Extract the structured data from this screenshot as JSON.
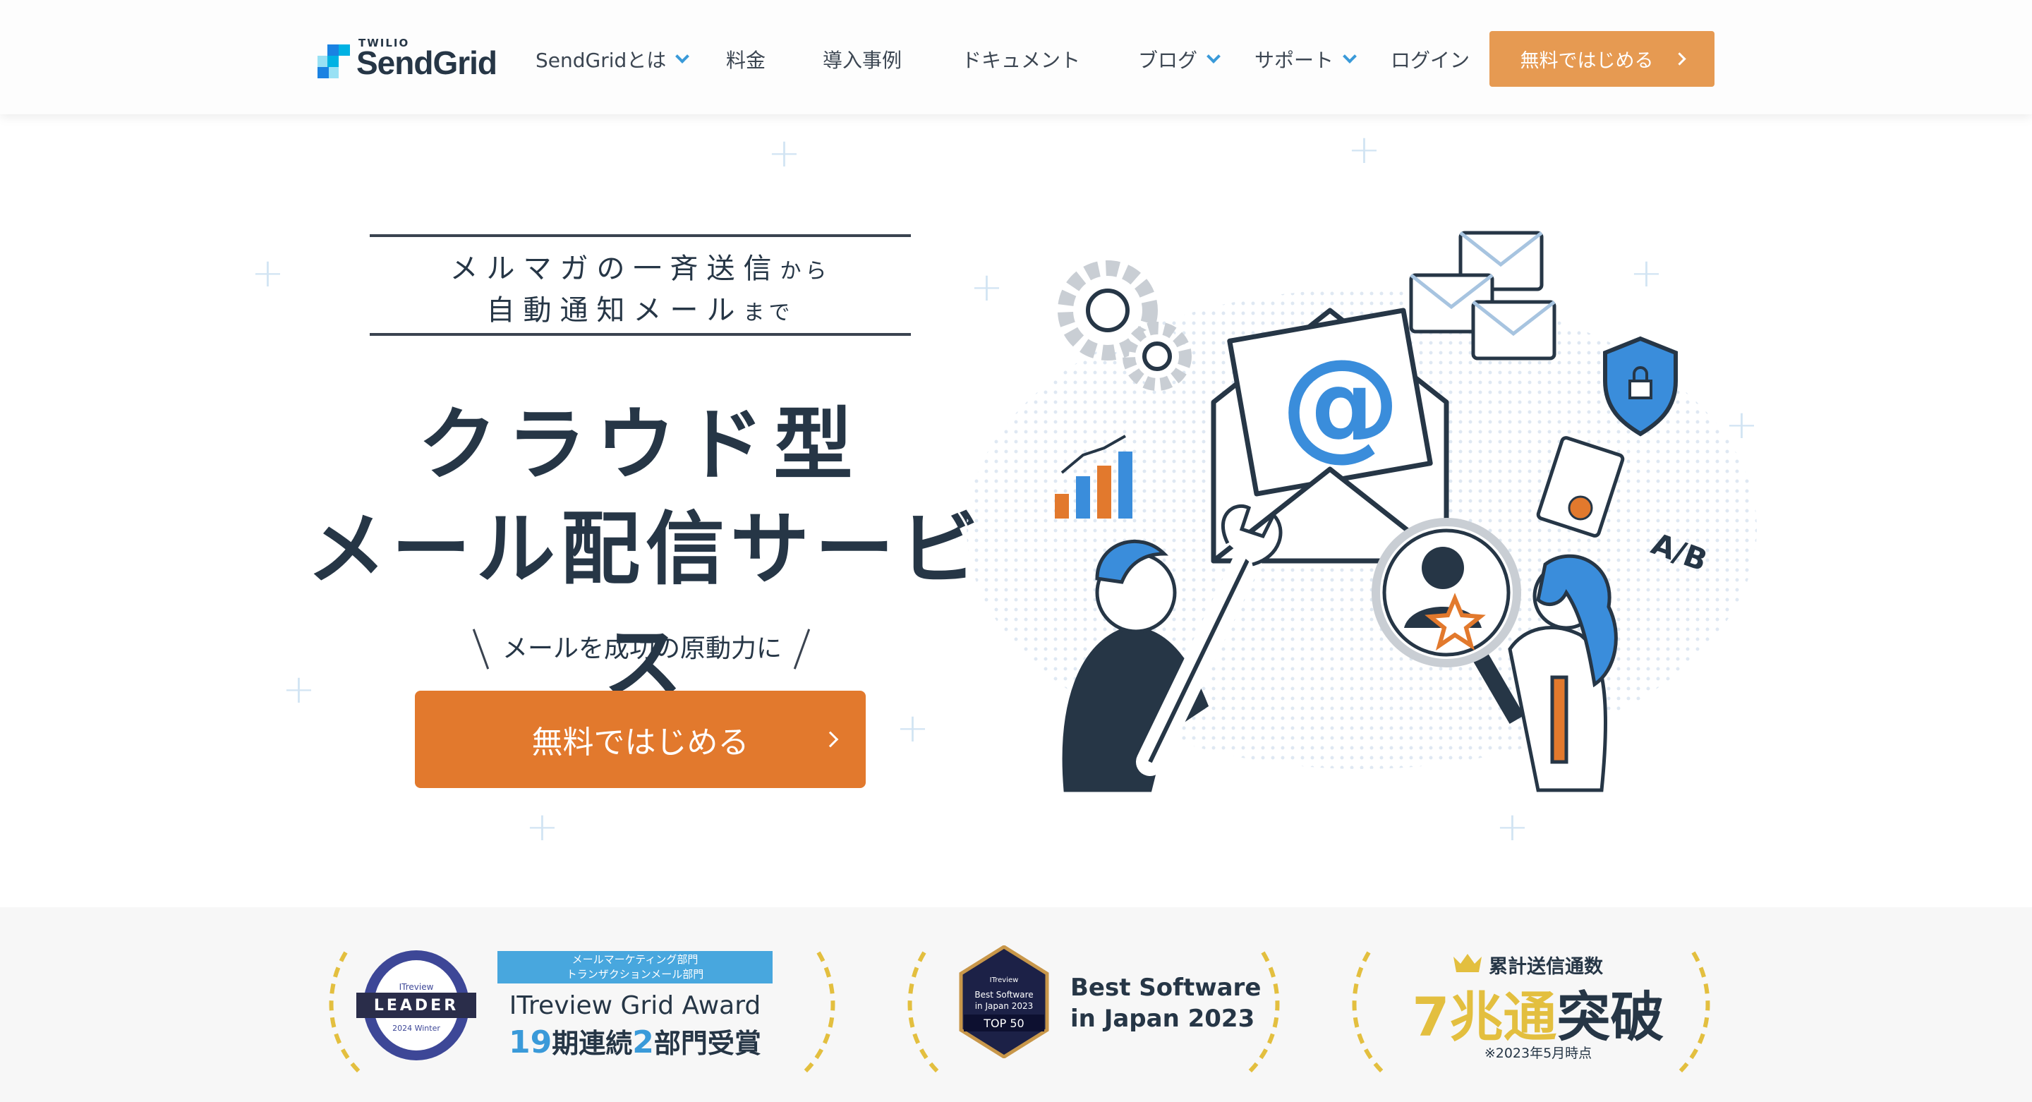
{
  "header": {
    "logo": {
      "small": "TWILIO",
      "name": "SendGrid"
    },
    "nav": [
      {
        "label": "SendGridとは",
        "dropdown": true
      },
      {
        "label": "料金",
        "dropdown": false
      },
      {
        "label": "導入事例",
        "dropdown": false
      },
      {
        "label": "ドキュメント",
        "dropdown": false
      },
      {
        "label": "ブログ",
        "dropdown": true
      },
      {
        "label": "サポート",
        "dropdown": true
      },
      {
        "label": "ログイン",
        "dropdown": false
      }
    ],
    "cta_label": "無料ではじめる"
  },
  "hero": {
    "tagline_line1": "メルマガの一斉送信",
    "tagline_line1_small": "から",
    "tagline_line2": "自動通知メール",
    "tagline_line2_small": "まで",
    "headline_line1": "クラウド型",
    "headline_line2": "メール配信サービス",
    "subline": "メールを成功の原動力に",
    "cta_label": "無料ではじめる",
    "illustration_text": "A/B"
  },
  "awards": [
    {
      "badge_brand": "ITreview",
      "badge_title": "LEADER",
      "badge_season": "2024 Winter",
      "ribbon_line1": "メールマーケティング部門",
      "ribbon_line2": "トランザクションメール部門",
      "title": "ITreview Grid Award",
      "highlight_num1": "19",
      "text1": "期連続",
      "highlight_num2": "2",
      "text2": "部門受賞"
    },
    {
      "badge_brand": "ITreview",
      "badge_line1": "Best Software",
      "badge_line2": "in Japan 2023",
      "badge_rank": "TOP 50",
      "title_line1": "Best Software",
      "title_line2": "in Japan 2023"
    },
    {
      "label": "累計送信通数",
      "highlight": "7兆通",
      "text": "突破",
      "note": "※2023年5月時点"
    }
  ],
  "colors": {
    "orange": "#e2792d",
    "header_orange": "#e69a52",
    "navy": "#263646",
    "blue": "#3a9ad9",
    "gold": "#e3bf3f"
  }
}
